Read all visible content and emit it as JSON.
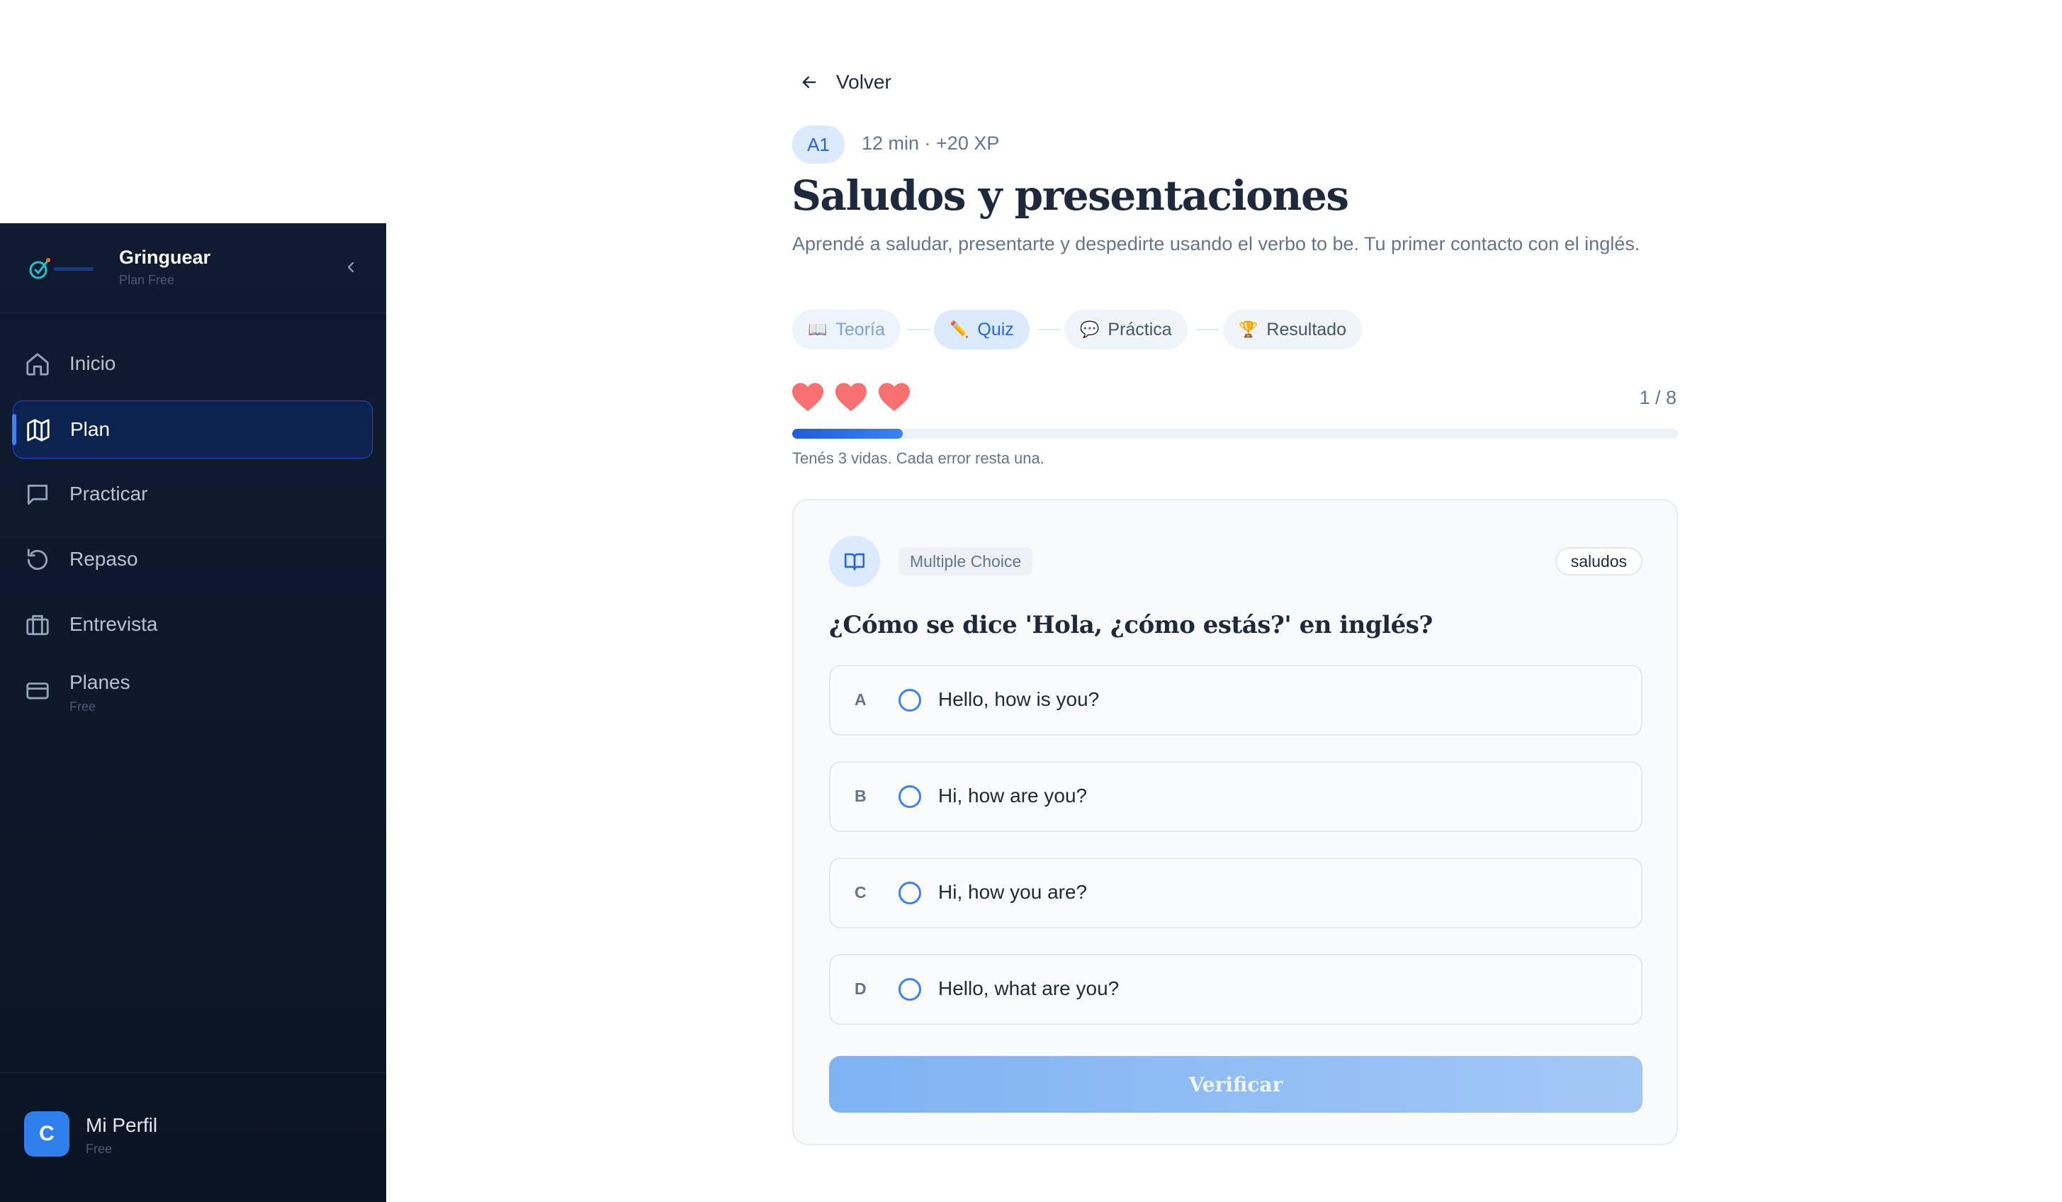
{
  "sidebar": {
    "brand_name": "Gringuear",
    "brand_plan": "Plan Free",
    "items": [
      {
        "label": "Inicio",
        "icon": "home-icon"
      },
      {
        "label": "Plan",
        "icon": "map-icon",
        "active": true
      },
      {
        "label": "Practicar",
        "icon": "chat-icon"
      },
      {
        "label": "Repaso",
        "icon": "refresh-icon"
      },
      {
        "label": "Entrevista",
        "icon": "briefcase-icon"
      },
      {
        "label": "Planes",
        "sub": "Free",
        "icon": "credit-card-icon"
      }
    ],
    "profile": {
      "initial": "C",
      "name": "Mi Perfil",
      "plan": "Free"
    }
  },
  "lesson": {
    "back_label": "Volver",
    "level": "A1",
    "meta": "12 min · +20 XP",
    "title": "Saludos y presentaciones",
    "description": "Aprendé a saludar, presentarte y despedirte usando el verbo to be. Tu primer contacto con el inglés.",
    "steps": [
      {
        "emoji": "📖",
        "label": "Teoría",
        "state": "done"
      },
      {
        "emoji": "✏️",
        "label": "Quiz",
        "state": "active"
      },
      {
        "emoji": "💬",
        "label": "Práctica",
        "state": "pending"
      },
      {
        "emoji": "🏆",
        "label": "Resultado",
        "state": "pending"
      }
    ]
  },
  "quiz": {
    "lives": 3,
    "counter": "1 / 8",
    "progress_fraction": 0.125,
    "lives_hint": "Tenés 3 vidas. Cada error resta una.",
    "type": "Multiple Choice",
    "tag": "saludos",
    "question": "¿Cómo se dice 'Hola, ¿cómo estás?' en inglés?",
    "options": [
      {
        "letter": "A",
        "text": "Hello, how is you?"
      },
      {
        "letter": "B",
        "text": "Hi, how are you?"
      },
      {
        "letter": "C",
        "text": "Hi, how you are?"
      },
      {
        "letter": "D",
        "text": "Hello, what are you?"
      }
    ],
    "verify_label": "Verificar"
  },
  "colors": {
    "accent": "#3b82f6",
    "sidebar_bg": "#0f1a2e",
    "heart": "#f87171",
    "verify_disabled": "#8fbcf4"
  }
}
